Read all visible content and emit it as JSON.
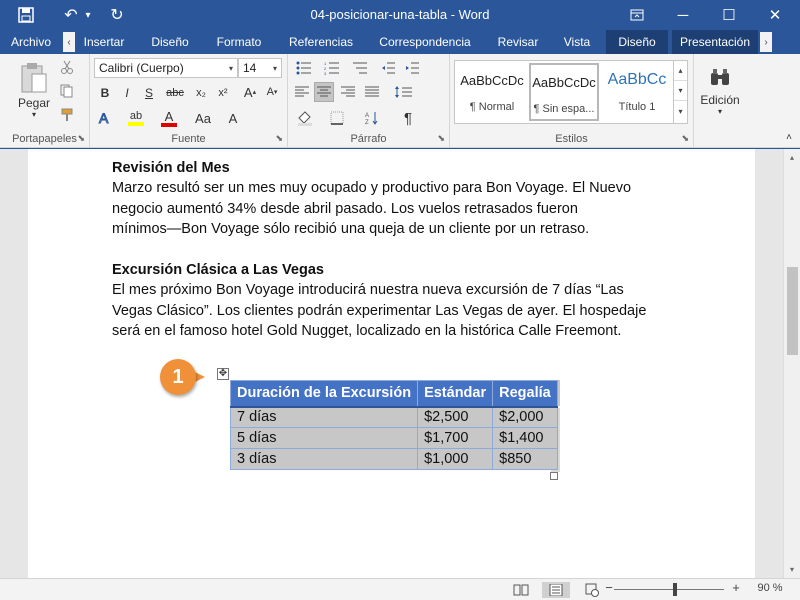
{
  "titlebar": {
    "title": "04-posicionar-una-tabla - Word",
    "save_icon": "save-icon",
    "undo_icon": "undo-icon",
    "redo_icon": "redo-icon",
    "ribbon_display_icon": "ribbon-display-icon",
    "minimize_icon": "minimize-icon",
    "maximize_icon": "maximize-icon",
    "close_icon": "close-icon",
    "undo_glyph": "↶",
    "undo_dropdown_glyph": "▾",
    "redo_glyph": "↻",
    "minimize_glyph": "─",
    "maximize_glyph": "☐",
    "close_glyph": "✕"
  },
  "tabs": {
    "items": [
      {
        "label": "Archivo"
      },
      {
        "label": "Insertar"
      },
      {
        "label": "Diseño"
      },
      {
        "label": "Formato"
      },
      {
        "label": "Referencias"
      },
      {
        "label": "Correspondencia"
      },
      {
        "label": "Revisar"
      },
      {
        "label": "Vista"
      },
      {
        "label": "Diseño"
      },
      {
        "label": "Presentación"
      }
    ],
    "scroll_left_glyph": "‹",
    "scroll_right_glyph": "›"
  },
  "ribbon": {
    "clipboard": {
      "paste_label": "Pegar",
      "group_label": "Portapapeles",
      "cut_icon": "scissors-icon",
      "copy_icon": "copy-icon",
      "format_painter_icon": "format-painter-icon"
    },
    "font": {
      "font_name": "Calibri (Cuerpo)",
      "font_size": "14",
      "group_label": "Fuente",
      "bold": "B",
      "italic": "I",
      "underline": "S",
      "strikethrough": "abc",
      "subscript": "x₂",
      "superscript": "x²",
      "highlight_label": "ab",
      "font_color_label": "A",
      "change_case_label": "Aa",
      "clear_formatting_label": "A"
    },
    "paragraph": {
      "group_label": "Párrafo",
      "pilcrow": "¶"
    },
    "styles": {
      "group_label": "Estilos",
      "items": [
        {
          "sample": "AaBbCcDc",
          "name": "¶ Normal"
        },
        {
          "sample": "AaBbCcDc",
          "name": "¶ Sin espa..."
        },
        {
          "sample": "AaBbCc",
          "name": "Título 1"
        }
      ]
    },
    "editing": {
      "label": "Edición"
    }
  },
  "document": {
    "p1_heading": "Revisión del Mes",
    "p1_lines": [
      "Marzo resultó ser un mes muy ocupado y productivo para Bon Voyage. El Nuevo",
      "negocio aumentó 34% desde abril pasado. Los vuelos retrasados fueron",
      "mínimos—Bon Voyage sólo recibió una queja de un cliente por un retraso."
    ],
    "p2_heading": "Excursión Clásica a Las Vegas",
    "p2_lines": [
      "El mes próximo Bon Voyage introducirá nuestra nueva excursión de 7 días “Las",
      "Vegas Clásico”. Los clientes podrán experimentar Las Vegas de ayer. El hospedaje",
      "será en el famoso hotel Gold Nugget, localizado en la histórica Calle Freemont."
    ],
    "table": {
      "headers": [
        "Duración de la Excursión",
        "Estándar",
        "Regalía"
      ],
      "rows": [
        [
          "7 días",
          "$2,500",
          "$2,000"
        ],
        [
          "5 días",
          "$1,700",
          "$1,400"
        ],
        [
          "3 días",
          "$1,000",
          "$850"
        ]
      ]
    },
    "callout_number": "1",
    "move_handle_glyph": "✥"
  },
  "statusbar": {
    "zoom_level": "90 %",
    "zoom_minus": "−",
    "zoom_plus": "+"
  },
  "colors": {
    "brand": "#2b579a",
    "table_header": "#4472c4",
    "callout": "#f0913a",
    "selection": "#c7c7c7"
  }
}
